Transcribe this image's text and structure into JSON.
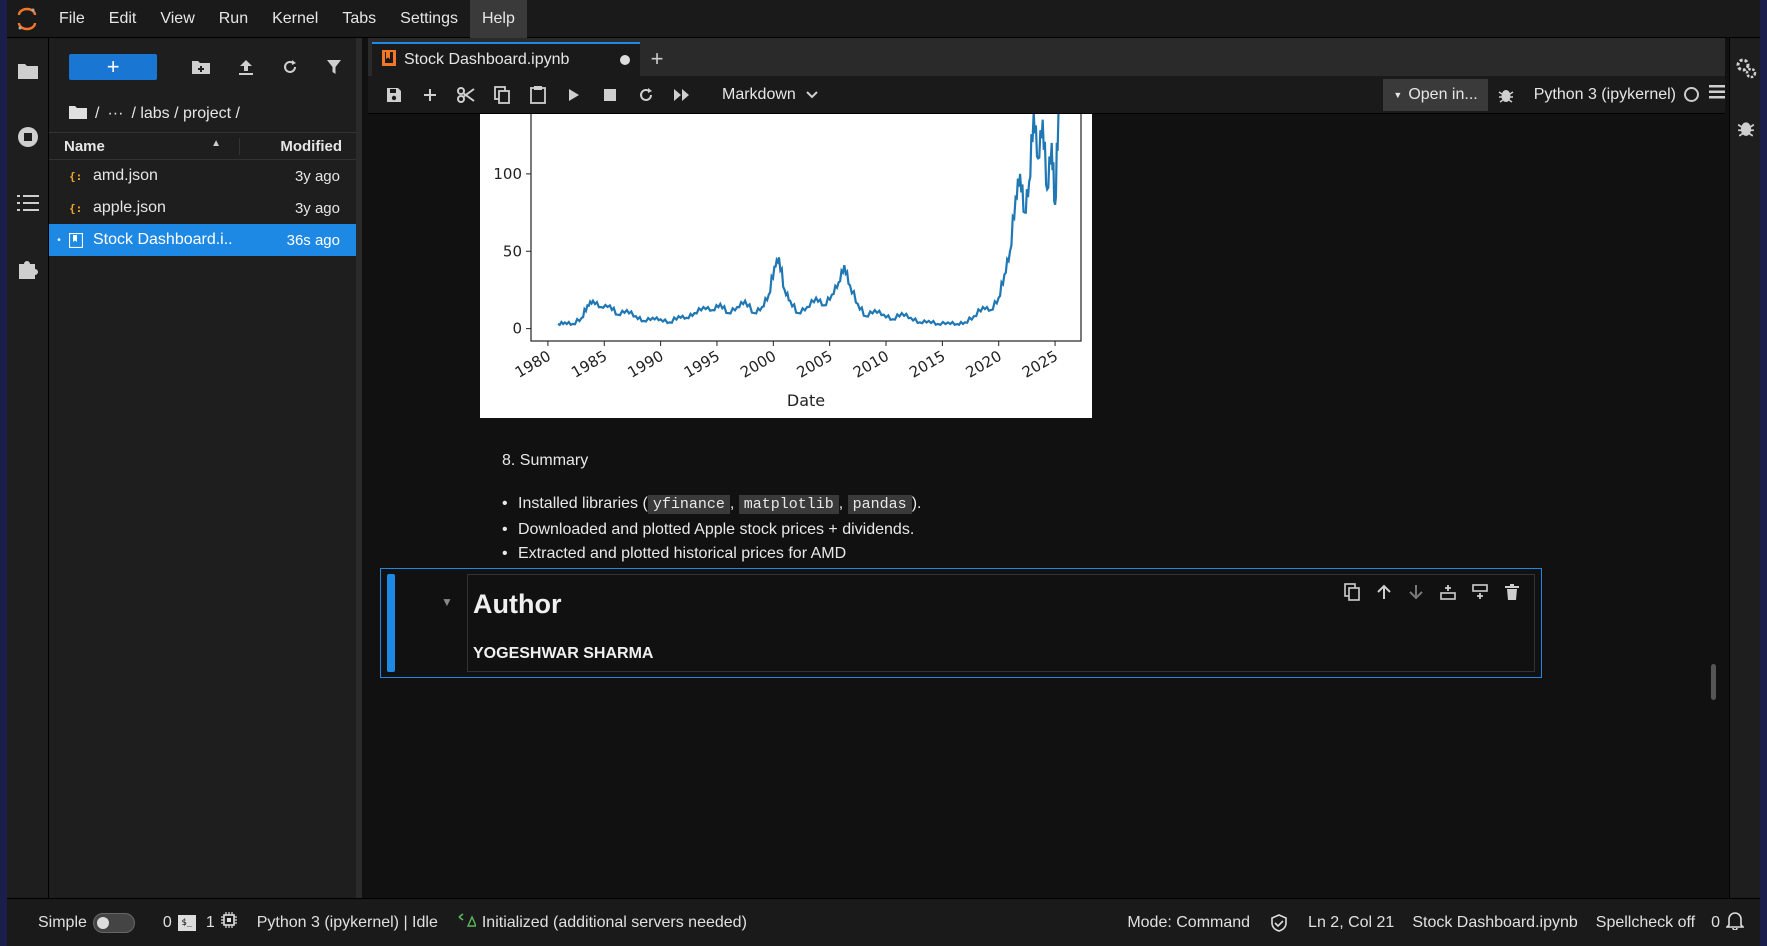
{
  "menubar": {
    "items": [
      "File",
      "Edit",
      "View",
      "Run",
      "Kernel",
      "Tabs",
      "Settings",
      "Help"
    ]
  },
  "filebrowser": {
    "new_label": "+",
    "breadcrumb": [
      "/",
      "···",
      "/ labs / project /"
    ],
    "col_name": "Name",
    "col_modified": "Modified",
    "files": [
      {
        "name": "amd.json",
        "modified": "3y ago",
        "icon": "json-icon",
        "selected": false
      },
      {
        "name": "apple.json",
        "modified": "3y ago",
        "icon": "json-icon",
        "selected": false
      },
      {
        "name": "Stock Dashboard.i...",
        "modified": "36s ago",
        "icon": "notebook-icon",
        "selected": true
      }
    ]
  },
  "tab": {
    "title": "Stock Dashboard.ipynb",
    "add": "+"
  },
  "toolbar": {
    "cell_type": "Markdown",
    "open_in": "Open in...",
    "kernel": "Python 3 (ipykernel)"
  },
  "plot": {
    "yticks": [
      "100",
      "50",
      "0"
    ],
    "xticks": [
      "1980",
      "1985",
      "1990",
      "1995",
      "2000",
      "2005",
      "2010",
      "2015",
      "2020",
      "2025"
    ],
    "xlabel": "Date"
  },
  "chart_data": {
    "type": "line",
    "xlabel": "Date",
    "ylabel": "",
    "xlim": [
      1978.5,
      2027.3
    ],
    "ylim": [
      -8,
      140
    ],
    "x": [
      1980.9,
      1981.5,
      1982.2,
      1983.0,
      1983.5,
      1984.0,
      1984.7,
      1985.5,
      1986.2,
      1987.0,
      1987.8,
      1988.5,
      1989.3,
      1990.0,
      1990.8,
      1991.6,
      1992.3,
      1993.0,
      1993.8,
      1994.6,
      1995.3,
      1996.0,
      1996.8,
      1997.5,
      1998.3,
      1999.0,
      1999.6,
      2000.1,
      2000.5,
      2001.0,
      2001.5,
      2002.2,
      2003.0,
      2003.8,
      2004.5,
      2005.2,
      2005.8,
      2006.3,
      2006.8,
      2007.5,
      2008.2,
      2009.0,
      2009.8,
      2010.6,
      2011.4,
      2012.2,
      2013.0,
      2013.8,
      2014.6,
      2015.5,
      2016.3,
      2017.0,
      2017.8,
      2018.6,
      2019.3,
      2020.0,
      2020.5,
      2021.0,
      2021.5,
      2021.9,
      2022.3,
      2022.7,
      2023.1,
      2023.5,
      2023.9,
      2024.3,
      2024.7,
      2025.0,
      2025.3
    ],
    "y": [
      3,
      4,
      3,
      7,
      15,
      18,
      14,
      15,
      9,
      12,
      8,
      5,
      7,
      6,
      4,
      8,
      7,
      10,
      14,
      12,
      16,
      10,
      14,
      18,
      10,
      14,
      22,
      40,
      46,
      25,
      18,
      10,
      14,
      20,
      15,
      22,
      30,
      41,
      28,
      16,
      8,
      12,
      9,
      6,
      10,
      7,
      4,
      5,
      3,
      4,
      3,
      4,
      8,
      14,
      12,
      20,
      35,
      50,
      85,
      100,
      75,
      95,
      140,
      110,
      135,
      90,
      120,
      80,
      140
    ]
  },
  "markdown": {
    "summary_title": "8. Summary",
    "bullet1_prefix": "Installed libraries (",
    "lib1": "yfinance",
    "lib2": "matplotlib",
    "lib3": "pandas",
    "bullet1_suffix": ").",
    "sep": ",",
    "bullet2": "Downloaded and plotted Apple stock prices + dividends.",
    "bullet3": "Extracted and plotted historical prices for AMD",
    "author_heading": "Author",
    "author_name": "YOGESHWAR SHARMA"
  },
  "statusbar": {
    "simple": "Simple",
    "terminals_count": "0",
    "kernels_count": "1",
    "kernel_status": "Python 3 (ipykernel) | Idle",
    "lsp_status": "Initialized (additional servers needed)",
    "mode": "Mode: Command",
    "position": "Ln 2, Col 21",
    "filename": "Stock Dashboard.ipynb",
    "spellcheck": "Spellcheck off",
    "notifications": "0"
  }
}
